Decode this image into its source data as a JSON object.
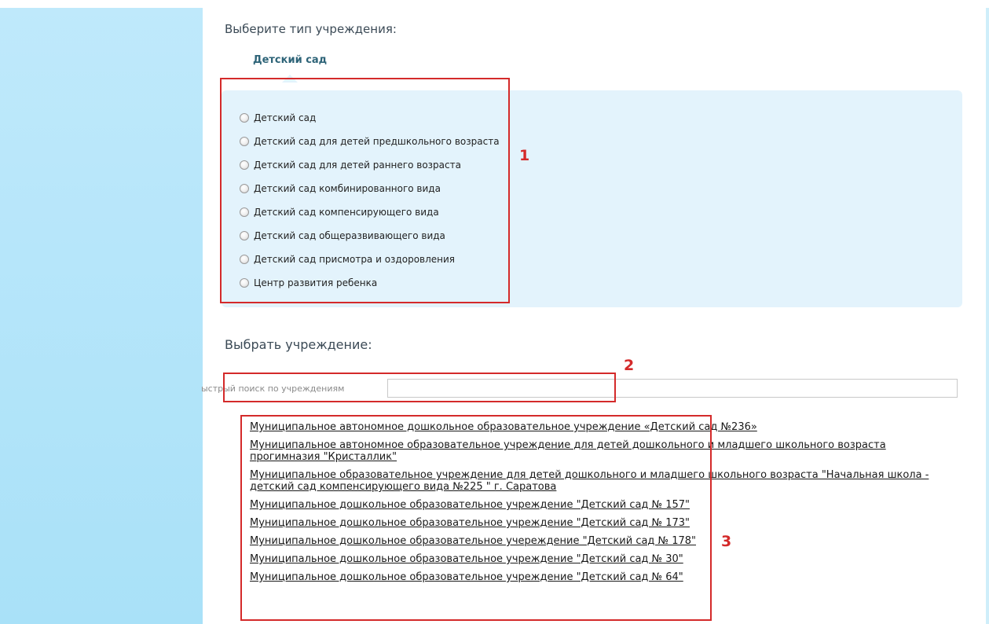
{
  "section_type": {
    "heading": "Выберите тип учреждения:",
    "tab_label": "Детский сад",
    "options": [
      "Детский сад",
      "Детский сад для детей предшкольного возраста",
      "Детский сад для детей раннего возраста",
      "Детский сад комбинированного вида",
      "Детский сад компенсирующего вида",
      "Детский сад общеразвивающего вида",
      "Детский сад присмотра и оздоровления",
      "Центр развития ребенка"
    ]
  },
  "section_institution": {
    "heading": "Выбрать учреждение:",
    "search_label": "ыстрый поиск по учреждениям",
    "search_value": "",
    "institutions": [
      "Муниципальное автономное дошкольное образовательное учреждение «Детский сад №236»",
      "Муниципальное автономное образовательное учреждение для детей дошкольного и младшего школьного возраста прогимназия \"Кристаллик\"",
      "Муниципальное образовательное учреждение для детей дошкольного и младшего школьного возраста \"Начальная школа - детский сад компенсирующего вида №225 \" г. Саратова",
      "Муниципальное дошкольное образовательное учреждение \"Детский сад № 157\"",
      "Муниципальное дошкольное образовательное учреждение \"Детский сад № 173\"",
      "Муниципальное дошкольное образовательное учереждение \"Детский сад № 178\"",
      "Муниципальное дошкольное образовательное учреждение \"Детский сад № 30\"",
      "Муниципальное дошкольное образовательное учреждение \"Детский сад № 64\""
    ]
  },
  "annotations": {
    "box1": "1",
    "box2": "2",
    "box3": "3"
  },
  "colors": {
    "annotation": "#d42a2a",
    "panel": "#e3f3fc",
    "sidebar": "#a9e1f8",
    "tab_text": "#2e6478"
  }
}
